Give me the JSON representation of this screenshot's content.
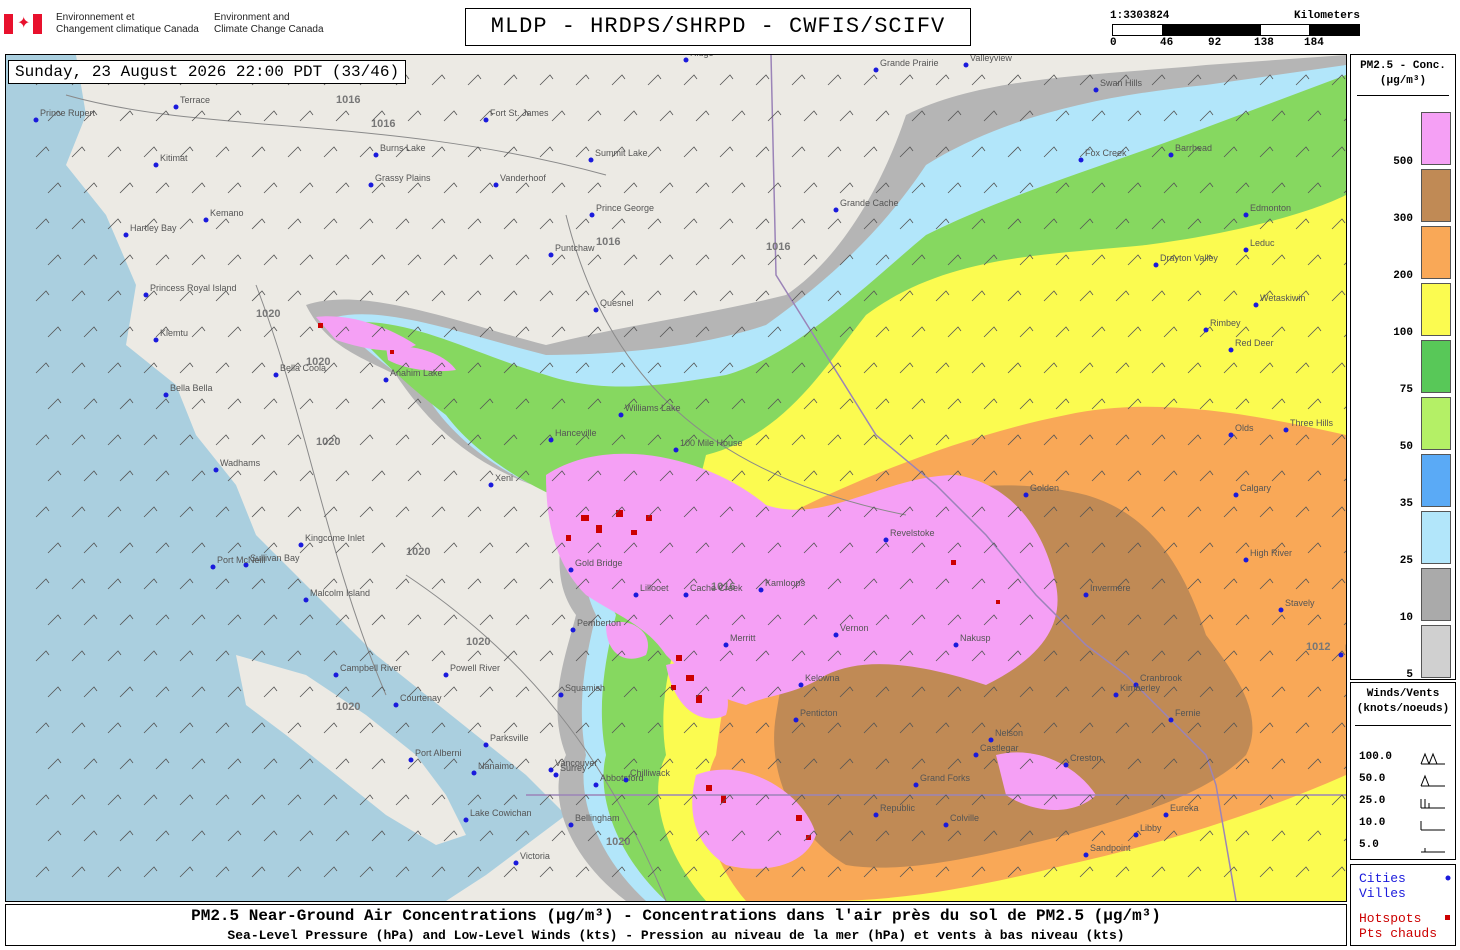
{
  "header": {
    "agency_fr": [
      "Environnement et",
      "Changement climatique Canada"
    ],
    "agency_en": [
      "Environment and",
      "Climate Change Canada"
    ],
    "title": "MLDP - HRDPS/SHRPD - CWFIS/SCIFV",
    "timestamp": "Sunday, 23 August 2026 22:00 PDT (33/46)"
  },
  "scale": {
    "ratio": "1:3303824",
    "unit": "Kilometers",
    "ticks": [
      "0",
      "46",
      "92",
      "138",
      "184"
    ]
  },
  "legend_pm": {
    "title": [
      "PM2.5 - Conc.",
      "(μg/m³)"
    ],
    "classes": [
      {
        "label": "500",
        "color": "#f5a0f5"
      },
      {
        "label": "300",
        "color": "#c08a55"
      },
      {
        "label": "200",
        "color": "#f9a857"
      },
      {
        "label": "100",
        "color": "#fbfb50"
      },
      {
        "label": "75",
        "color": "#58c858"
      },
      {
        "label": "50",
        "color": "#b4f066"
      },
      {
        "label": "35",
        "color": "#5aaaf6"
      },
      {
        "label": "25",
        "color": "#b2e6fa"
      },
      {
        "label": "10",
        "color": "#aaaaaa"
      },
      {
        "label": "5",
        "color": "#d0d0d0"
      }
    ]
  },
  "legend_wind": {
    "title": [
      "Winds/Vents",
      "(knots/noeuds)"
    ],
    "rows": [
      "100.0",
      "50.0",
      "25.0",
      "10.0",
      "5.0"
    ]
  },
  "legend_symbols": {
    "cities": [
      "Cities",
      "Villes"
    ],
    "hotspots": [
      "Hotspots",
      "Pts chauds"
    ],
    "city_color": "#1a1adc",
    "hotspot_color": "#cc0000"
  },
  "footer": {
    "line1": "PM2.5 Near-Ground Air Concentrations (μg/m³) - Concentrations dans l'air près du sol de PM2.5 (μg/m³)",
    "line2": "Sea-Level Pressure (hPa) and Low-Level Winds (kts) - Pression au niveau de la mer (hPa) et vents à bas niveau (kts)"
  },
  "map": {
    "isobars": [
      "1016",
      "1016",
      "1016",
      "1016",
      "1020",
      "1020",
      "1020",
      "1020",
      "1020",
      "1016",
      "1020",
      "1020",
      "1012"
    ],
    "cities": [
      "Prince Rupert",
      "Terrace",
      "Kitimat",
      "Kemano",
      "Hartley Bay",
      "Princess Royal Island",
      "Klemtu",
      "Bella Bella",
      "Bella Coola",
      "Anahim Lake",
      "Wadhams",
      "Sullivan Bay",
      "Kingcome Inlet",
      "Port McNeill",
      "Malcolm Island",
      "Campbell River",
      "Powell River",
      "Courtenay",
      "Port Alberni",
      "Parksville",
      "Nanaimo",
      "Lake Cowichan",
      "Vancouver",
      "Surrey",
      "Abbotsford",
      "Chilliwack",
      "Bellingham",
      "Victoria",
      "Squamish",
      "Pemberton",
      "Lillooet",
      "Gold Bridge",
      "Cache Creek",
      "Kamloops",
      "Merritt",
      "Hanceville",
      "Williams Lake",
      "Quesnel",
      "Puntchaw",
      "Vanderhoof",
      "Prince George",
      "Summit Lake",
      "Fort St. James",
      "Burns Lake",
      "Grassy Plains",
      "Xeni",
      "Grande Cache",
      "Grande Prairie",
      "Valleyview",
      "Swan Hills",
      "Fox Creek",
      "Barrhead",
      "Edmonton",
      "Drayton Valley",
      "Leduc",
      "Wetaskiwin",
      "Rimbey",
      "Red Deer",
      "Three Hills",
      "Olds",
      "Calgary",
      "High River",
      "Stavely",
      "Lethbridge",
      "Revelstoke",
      "Golden",
      "Invermere",
      "Cranbrook",
      "Fernie",
      "Nelson",
      "Castlegar",
      "Creston",
      "Nakusp",
      "Vernon",
      "Kelowna",
      "Penticton",
      "Grand Forks",
      "Republic",
      "Colville",
      "Sandpoint",
      "Libby",
      "Eureka",
      "Kimberley",
      "100 Mile House",
      "Ridge"
    ]
  }
}
